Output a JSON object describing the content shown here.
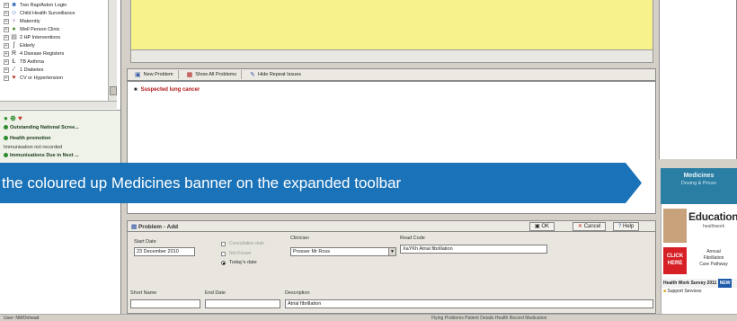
{
  "left_tree": {
    "items": [
      {
        "label": "Two Rap/Aston Login",
        "icon": "person-icon",
        "color": "#3a6dbf"
      },
      {
        "label": "Child Health Surveillance",
        "icon": "child-icon",
        "color": "#3a6dbf"
      },
      {
        "label": "Maternity",
        "icon": "pregnant-icon",
        "color": "#8a4b9e"
      },
      {
        "label": "Well Person Clinic",
        "icon": "person-icon",
        "color": "#4a8a2a"
      },
      {
        "label": "2 HP Interventions",
        "icon": "clipboard-icon",
        "color": "#555555"
      },
      {
        "label": "Elderly",
        "icon": "elderly-icon",
        "color": "#333333"
      },
      {
        "label": "4 Disease Registers",
        "icon": "register-icon",
        "color": "#333333"
      },
      {
        "label": "TB Asthma",
        "icon": "lungs-icon",
        "color": "#333333"
      },
      {
        "label": "1 Diabetes",
        "icon": "syringe-icon",
        "color": "#333333"
      },
      {
        "label": "CV or Hypertension",
        "icon": "heart-icon",
        "color": "#c0392b"
      }
    ]
  },
  "alerts": {
    "outstanding": "Outstanding National Scree...",
    "health_promotion": "Health promotion",
    "immunisation_recorded": "Immunisation not recorded",
    "immunisations_due": "Immunisations Due in Next ..."
  },
  "problem_toolbar": {
    "new_problem": "New Problem",
    "show_all": "Show All Problems",
    "hide_repeat": "Hide Repeat Issues"
  },
  "problem_list": {
    "row_1": "Suspected lung cancer"
  },
  "callout": {
    "text": "the coloured up Medicines banner on the expanded toolbar",
    "color": "#1a72b8"
  },
  "medicines_banner": {
    "title": "Medicines",
    "subtitle": "Dosing & Prices",
    "color": "#2a7da3"
  },
  "ads": {
    "education": "Education",
    "education_sub": "healthwork",
    "click_here": "CLICK HERE",
    "ad_line_1": "Annual",
    "ad_line_2": "Fibrillation",
    "ad_line_3": "Care Pathway",
    "survey": "Health Work Survey 2011",
    "survey_tag": "NEW",
    "support": "Support Services"
  },
  "form": {
    "title": "Problem - Add",
    "ok_label": "OK",
    "cancel_label": "Cancel",
    "help_label": "Help",
    "start_date_label": "Start Date",
    "start_date_value": "23 December 2010",
    "consultation_date_label": "Consultation date",
    "not_known_label": "Not Known",
    "today_label": "Today's date",
    "clinician_label": "Clinician",
    "clinician_value": "Prosser Mr Ross",
    "read_code_label": "Read Code",
    "read_code_value": "XaYKh Atrial fibrillation",
    "short_name_label": "Short Name",
    "end_date_label": "End Date",
    "description_label": "Description",
    "description_value": "Atrial fibrillation"
  },
  "status_bar": {
    "left": "User: NWOnhead",
    "right": "Flying Problems     Patient Details     Health Record     Medication"
  }
}
